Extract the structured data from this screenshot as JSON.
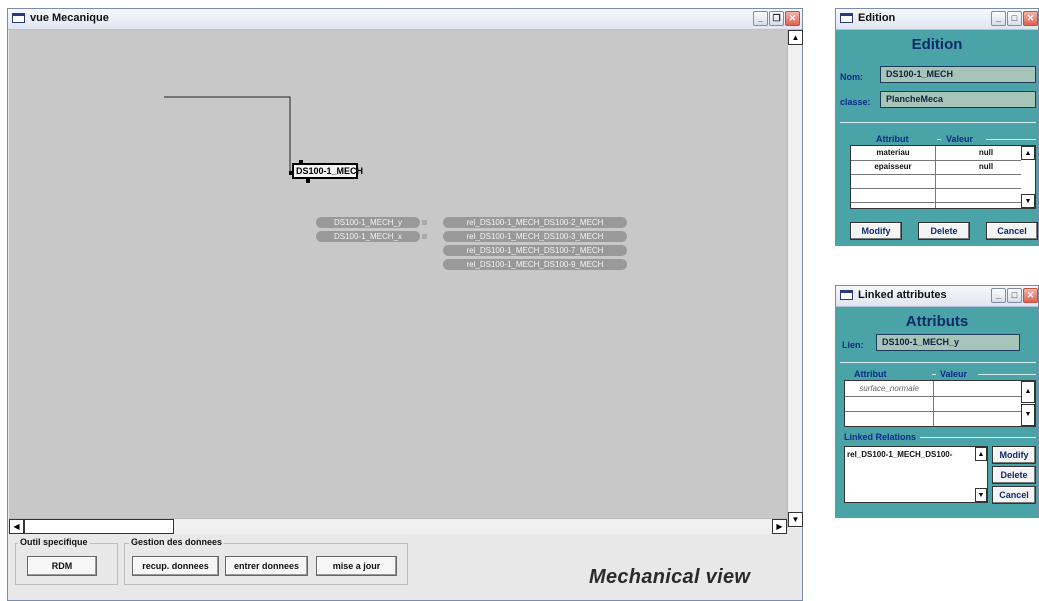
{
  "main_window": {
    "title": "vue Mecanique",
    "node_label": "DS100-1_MECH",
    "attribute_pills": [
      "DS100-1_MECH_y",
      "DS100-1_MECH_x"
    ],
    "relation_pills": [
      "rel_DS100-1_MECH_DS100-2_MECH",
      "rel_DS100-1_MECH_DS100-3_MECH",
      "rel_DS100-1_MECH_DS100-7_MECH",
      "rel_DS100-1_MECH_DS100-9_MECH"
    ],
    "outil_group_label": "Outil specifique",
    "rdm_button": "RDM",
    "gestion_group_label": "Gestion des donnees",
    "recup_button": "recup. donnees",
    "entrer_button": "entrer donnees",
    "maj_button": "mise a jour",
    "caption": "Mechanical view"
  },
  "edition_window": {
    "title": "Edition",
    "heading": "Edition",
    "nom_label": "Nom:",
    "nom_value": "DS100-1_MECH",
    "classe_label": "classe:",
    "classe_value": "PlancheMeca",
    "col_attribut": "Attribut",
    "col_valeur": "Valeur",
    "rows": [
      {
        "attribut": "materiau",
        "valeur": "null"
      },
      {
        "attribut": "epaisseur",
        "valeur": "null"
      }
    ],
    "modify_button": "Modify",
    "delete_button": "Delete",
    "cancel_button": "Cancel"
  },
  "linked_window": {
    "title": "Linked attributes",
    "heading": "Attributs",
    "lien_label": "Lien:",
    "lien_value": "DS100-1_MECH_y",
    "col_attribut": "Attribut",
    "col_valeur": "Valeur",
    "attr_row": "surface_normale",
    "linked_relations_label": "Linked Relations",
    "relation_item": "rel_DS100-1_MECH_DS100-",
    "modify_button": "Modify",
    "delete_button": "Delete",
    "cancel_button": "Cancel"
  },
  "colors": {
    "dialog_bg": "#4aa3a6",
    "canvas_bg": "#c8c8c8",
    "field_bg": "#a7c4b8"
  }
}
